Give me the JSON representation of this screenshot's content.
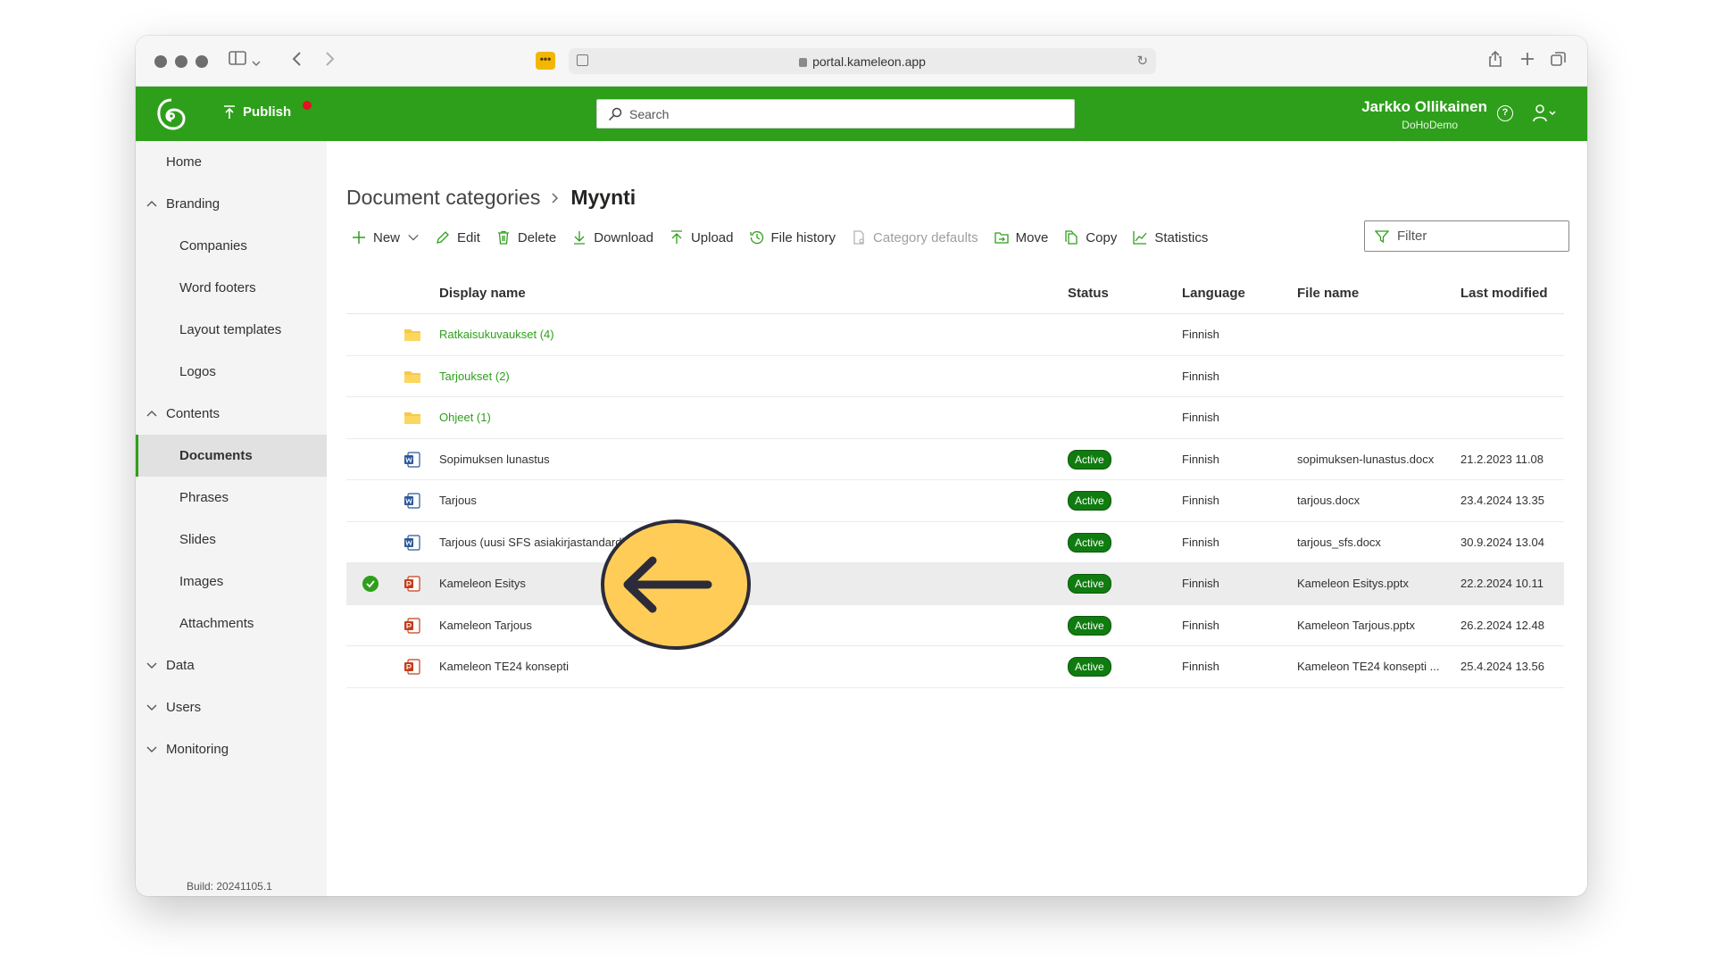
{
  "browser": {
    "url": "portal.kameleon.app"
  },
  "header": {
    "publish_label": "Publish",
    "search_placeholder": "Search",
    "user_name": "Jarkko Ollikainen",
    "user_org": "DoHoDemo",
    "help_glyph": "?"
  },
  "sidebar": {
    "items": [
      {
        "label": "Home"
      },
      {
        "label": "Branding"
      },
      {
        "label": "Companies"
      },
      {
        "label": "Word footers"
      },
      {
        "label": "Layout templates"
      },
      {
        "label": "Logos"
      },
      {
        "label": "Contents"
      },
      {
        "label": "Documents"
      },
      {
        "label": "Phrases"
      },
      {
        "label": "Slides"
      },
      {
        "label": "Images"
      },
      {
        "label": "Attachments"
      },
      {
        "label": "Data"
      },
      {
        "label": "Users"
      },
      {
        "label": "Monitoring"
      }
    ],
    "build": "Build: 20241105.1"
  },
  "breadcrumb": {
    "parent": "Document categories",
    "current": "Myynti"
  },
  "toolbar": {
    "new": "New",
    "edit": "Edit",
    "delete": "Delete",
    "download": "Download",
    "upload": "Upload",
    "file_history": "File history",
    "category_defaults": "Category defaults",
    "move": "Move",
    "copy": "Copy",
    "statistics": "Statistics",
    "filter_placeholder": "Filter"
  },
  "table": {
    "headers": {
      "display_name": "Display name",
      "status": "Status",
      "language": "Language",
      "file_name": "File name",
      "last_modified": "Last modified"
    },
    "rows": [
      {
        "type": "folder",
        "name": "Ratkaisukuvaukset (4)",
        "status": "",
        "language": "Finnish",
        "file": "",
        "modified": ""
      },
      {
        "type": "folder",
        "name": "Tarjoukset (2)",
        "status": "",
        "language": "Finnish",
        "file": "",
        "modified": ""
      },
      {
        "type": "folder",
        "name": "Ohjeet (1)",
        "status": "",
        "language": "Finnish",
        "file": "",
        "modified": ""
      },
      {
        "type": "word",
        "name": "Sopimuksen lunastus",
        "status": "Active",
        "language": "Finnish",
        "file": "sopimuksen-lunastus.docx",
        "modified": "21.2.2023 11.08"
      },
      {
        "type": "word",
        "name": "Tarjous",
        "status": "Active",
        "language": "Finnish",
        "file": "tarjous.docx",
        "modified": "23.4.2024 13.35"
      },
      {
        "type": "word",
        "name": "Tarjous (uusi SFS asiakirjastandardi)",
        "status": "Active",
        "language": "Finnish",
        "file": "tarjous_sfs.docx",
        "modified": "30.9.2024 13.04"
      },
      {
        "type": "ppt",
        "name": "Kameleon Esitys",
        "status": "Active",
        "language": "Finnish",
        "file": "Kameleon Esitys.pptx",
        "modified": "22.2.2024 10.11"
      },
      {
        "type": "ppt",
        "name": "Kameleon Tarjous",
        "status": "Active",
        "language": "Finnish",
        "file": "Kameleon Tarjous.pptx",
        "modified": "26.2.2024 12.48"
      },
      {
        "type": "ppt",
        "name": "Kameleon TE24 konsepti",
        "status": "Active",
        "language": "Finnish",
        "file": "Kameleon TE24 konsepti ...",
        "modified": "25.4.2024 13.56"
      }
    ]
  },
  "colors": {
    "brand": "#2e9f1a",
    "active_badge": "#107c10",
    "pointer_fill": "#ffcd57",
    "pointer_stroke": "#2b2b3a"
  }
}
